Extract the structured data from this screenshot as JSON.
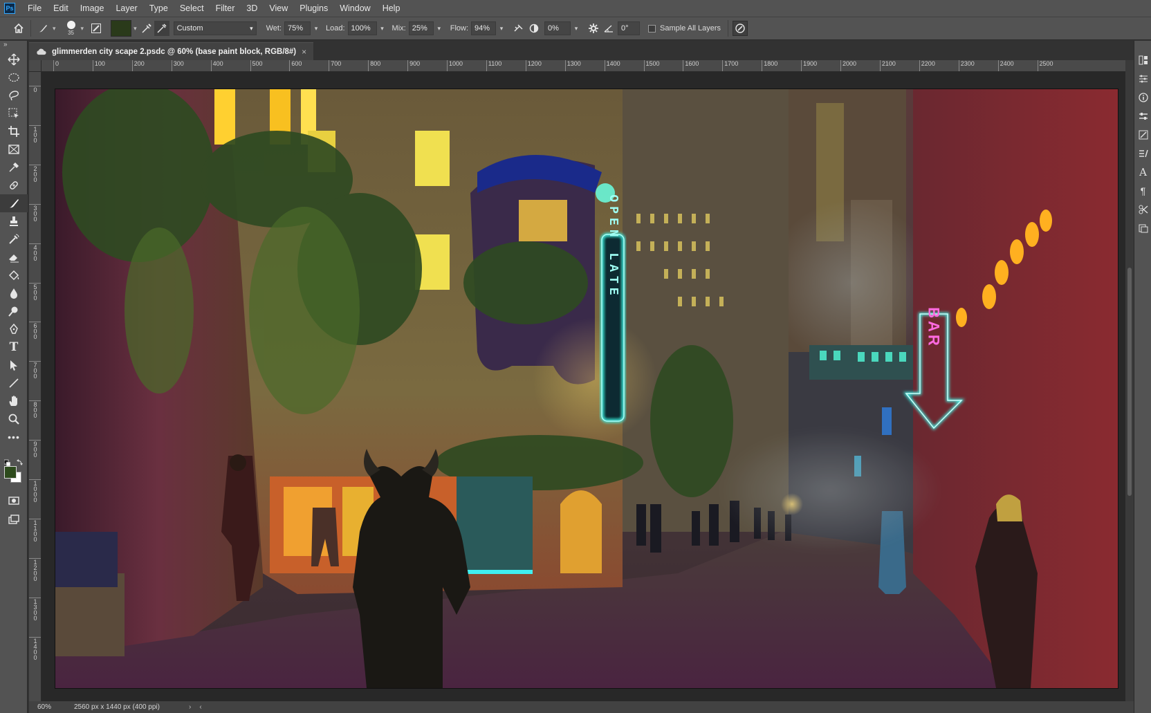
{
  "app": {
    "logo": "Ps"
  },
  "menu": [
    "File",
    "Edit",
    "Image",
    "Layer",
    "Type",
    "Select",
    "Filter",
    "3D",
    "View",
    "Plugins",
    "Window",
    "Help"
  ],
  "options": {
    "brush_size": "35",
    "preset": "Custom",
    "wet_label": "Wet:",
    "wet_value": "75%",
    "load_label": "Load:",
    "load_value": "100%",
    "mix_label": "Mix:",
    "mix_value": "25%",
    "flow_label": "Flow:",
    "flow_value": "94%",
    "smoothing_value": "0%",
    "angle_value": "0°",
    "sample_all_layers": "Sample All Layers"
  },
  "document": {
    "tab_title": "glimmerden city scape 2.psdc @ 60% (base paint block, RGB/8#)",
    "close": "×"
  },
  "rulers": {
    "horizontal": [
      "0",
      "100",
      "200",
      "300",
      "400",
      "500",
      "600",
      "700",
      "800",
      "900",
      "1000",
      "1100",
      "1200",
      "1300",
      "1400",
      "1500",
      "1600",
      "1700",
      "1800",
      "1900",
      "2000",
      "2100",
      "2200",
      "2300",
      "2400",
      "2500"
    ],
    "vertical": [
      "0",
      "1\n0\n0",
      "2\n0\n0",
      "3\n0\n0",
      "4\n0\n0",
      "5\n0\n0",
      "6\n0\n0",
      "7\n0\n0",
      "8\n0\n0",
      "9\n0\n0",
      "1\n0\n0\n0",
      "1\n1\n0\n0",
      "1\n2\n0\n0",
      "1\n3\n0\n0",
      "1\n4\n0\n0"
    ]
  },
  "canvas_text": {
    "open_late": "OPEN LATE",
    "bar": "BAR"
  },
  "status": {
    "zoom": "60%",
    "doc_size": "2560 px x 1440 px (400 ppi)",
    "arrow": "›",
    "left_arrow": "‹"
  },
  "colors": {
    "foreground": "#2d4a1c",
    "background": "#ffffff",
    "neon_cyan": "#3ff2e6",
    "neon_pink": "#ff4fd8"
  }
}
